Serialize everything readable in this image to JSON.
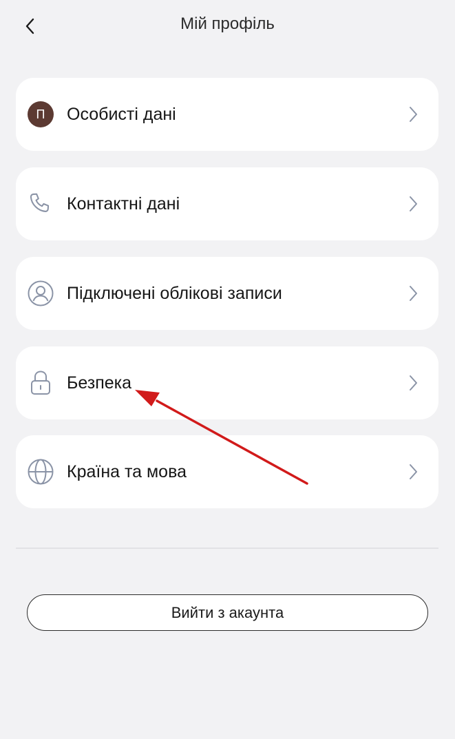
{
  "header": {
    "title": "Мій профіль",
    "back_icon": "chevron-left-icon"
  },
  "menu": {
    "items": [
      {
        "label": "Особисті дані",
        "icon": "avatar",
        "avatar_letter": "П"
      },
      {
        "label": "Контактні дані",
        "icon": "phone-icon"
      },
      {
        "label": "Підключені облікові записи",
        "icon": "user-circle-icon"
      },
      {
        "label": "Безпека",
        "icon": "lock-icon"
      },
      {
        "label": "Країна та мова",
        "icon": "globe-icon"
      }
    ],
    "chevron_icon": "chevron-right-icon"
  },
  "logout": {
    "label": "Вийти з акаунта"
  },
  "colors": {
    "background": "#f2f2f4",
    "card": "#ffffff",
    "avatar": "#5c3a32",
    "icon": "#8a93a6",
    "annotation_arrow": "#d11a1a"
  }
}
